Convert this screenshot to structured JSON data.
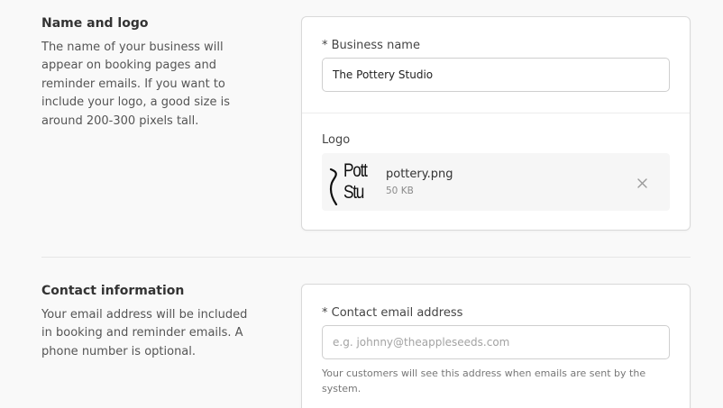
{
  "name_logo_section": {
    "title": "Name and logo",
    "description": "The name of your business will appear on booking pages and reminder emails. If you want to include your logo, a good size is around 200-300 pixels tall."
  },
  "business_name": {
    "label": "* Business name",
    "value": "The Pottery Studio"
  },
  "logo": {
    "label": "Logo",
    "thumbnail_text_line1": "Pott",
    "thumbnail_text_line2": "Stu",
    "file_name": "pottery.png",
    "file_size": "50 KB",
    "remove_icon": "close-icon"
  },
  "contact_section": {
    "title": "Contact information",
    "description": "Your email address will be included in booking and reminder emails. A phone number is optional."
  },
  "contact_email": {
    "label": "* Contact email address",
    "value": "",
    "placeholder": "e.g. johnny@theappleseeds.com",
    "help": "Your customers will see this address when emails are sent by the system."
  },
  "colors": {
    "background": "#f9f9f9",
    "card_border": "#d9d9d9",
    "text": "#333333",
    "muted": "#777777"
  }
}
